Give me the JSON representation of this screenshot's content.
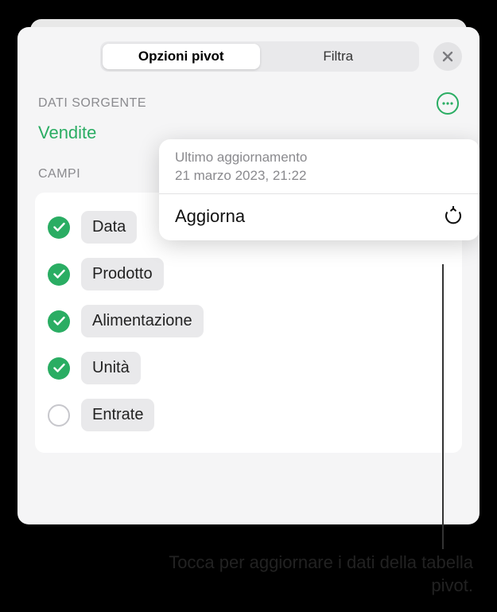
{
  "tabs": {
    "options": "Opzioni pivot",
    "filter": "Filtra"
  },
  "sections": {
    "source_label": "DATI SORGENTE",
    "source_name": "Vendite",
    "fields_label": "CAMPI"
  },
  "fields": [
    {
      "label": "Data",
      "checked": true
    },
    {
      "label": "Prodotto",
      "checked": true
    },
    {
      "label": "Alimentazione",
      "checked": true
    },
    {
      "label": "Unità",
      "checked": true
    },
    {
      "label": "Entrate",
      "checked": false
    }
  ],
  "popover": {
    "last_update_label": "Ultimo aggiornamento",
    "last_update_value": "21 marzo 2023, 21:22",
    "action_label": "Aggiorna"
  },
  "callout": {
    "text": "Tocca per aggiornare i dati della tabella pivot."
  }
}
